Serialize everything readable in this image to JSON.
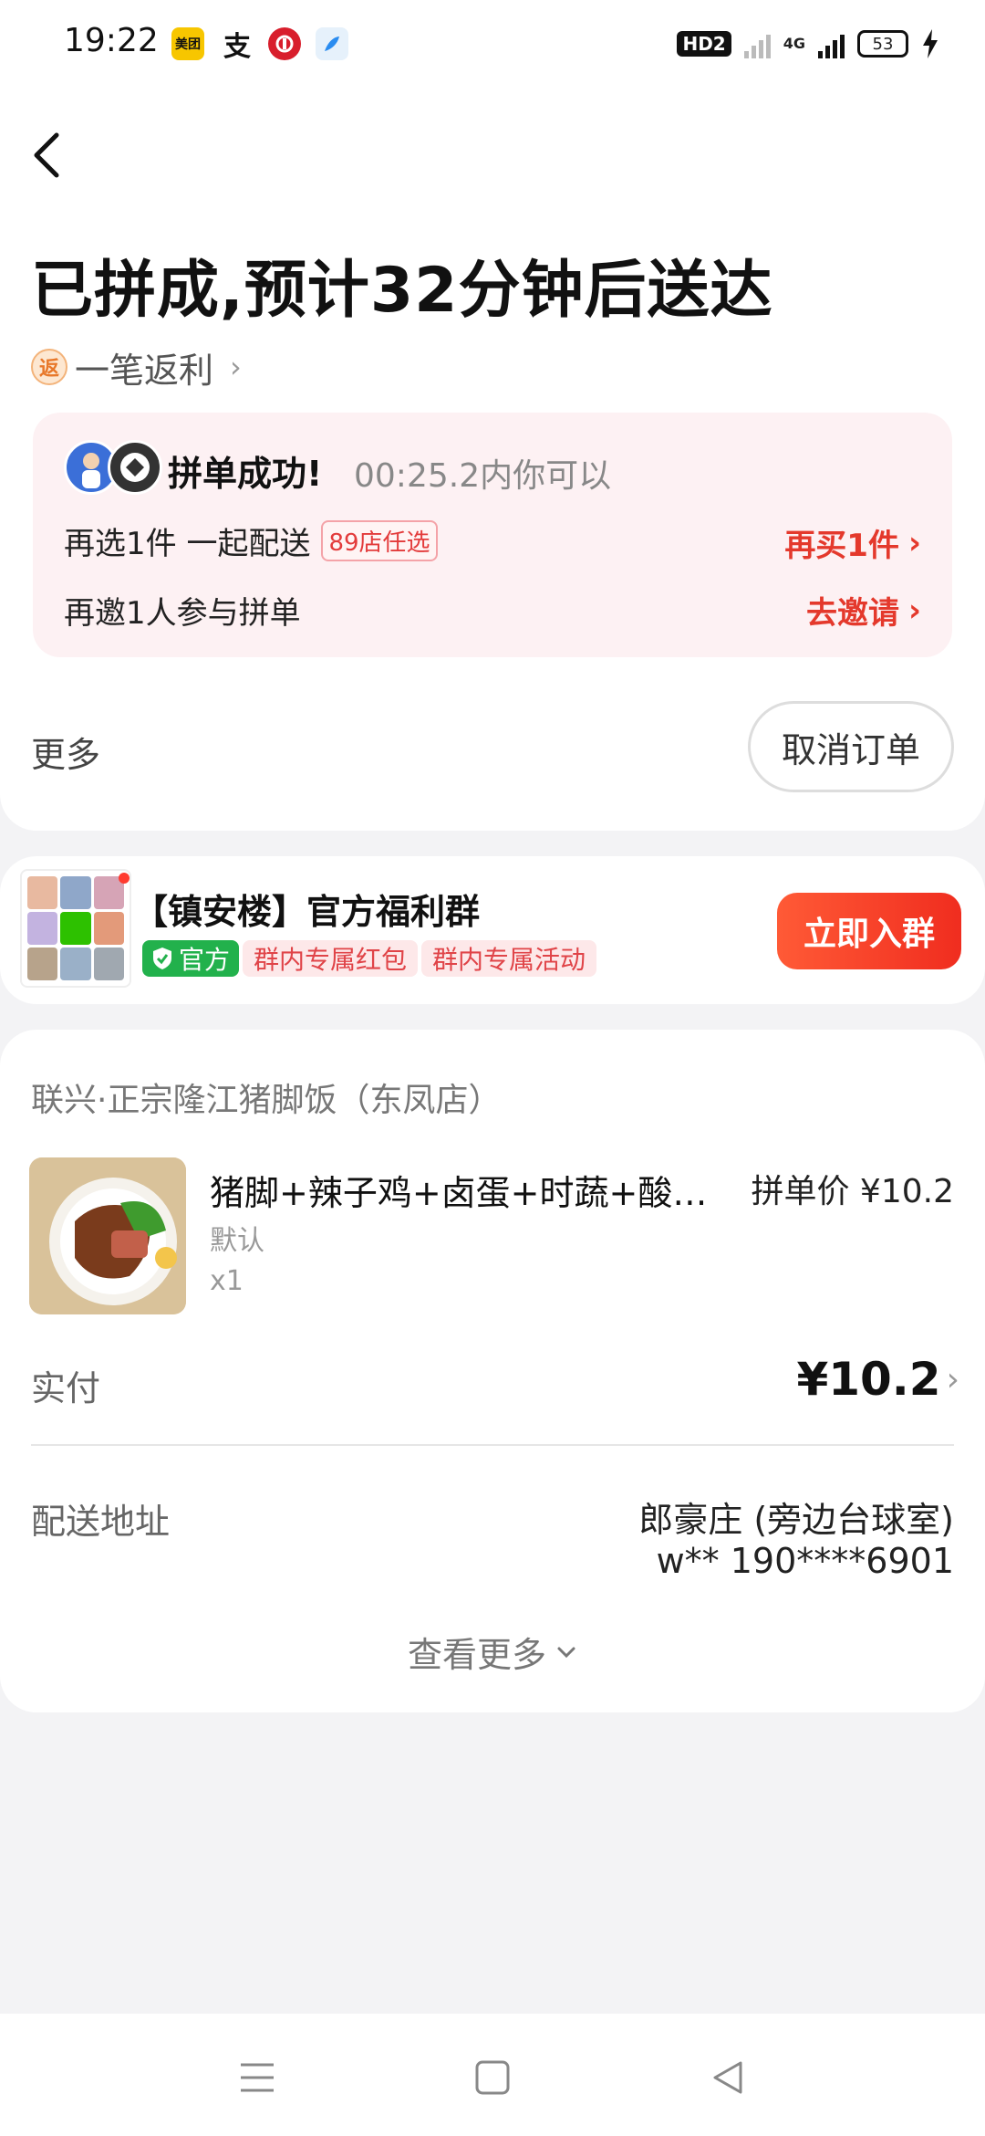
{
  "status_bar": {
    "time": "19:22",
    "app_icons": [
      "meituan-icon",
      "alipay-icon",
      "bank-icon",
      "feather-icon"
    ],
    "meituan_label": "美团",
    "alipay_label": "支",
    "hd_label": "HD2",
    "network_label": "4G",
    "battery_level": "53"
  },
  "header": {
    "title": "已拼成,预计32分钟后送达",
    "rebate_badge": "返",
    "rebate_text": "一笔返利"
  },
  "pin_card": {
    "success_text": "拼单成功!",
    "timer_text": "00:25.2内你可以",
    "row1_label": "再选1件 一起配送",
    "row1_tag": "89店任选",
    "row1_action": "再买1件",
    "row2_label": "再邀1人参与拼单",
    "row2_action": "去邀请"
  },
  "more_row": {
    "label": "更多",
    "cancel_button": "取消订单"
  },
  "group": {
    "title": "【镇安楼】官方福利群",
    "official_tag": "官方",
    "tag1": "群内专属红包",
    "tag2": "群内专属活动",
    "join_button": "立即入群"
  },
  "order": {
    "shop_name": "联兴·正宗隆江猪脚饭（东凤店）",
    "item": {
      "name": "猪脚+辣子鸡+卤蛋+时蔬+酸菜...",
      "price": "拼单价 ¥10.2",
      "spec": "默认",
      "quantity": "x1"
    },
    "paid_label": "实付",
    "paid_value": "¥10.2",
    "address_label": "配送地址",
    "address_main": "郎豪庄 (旁边台球室)",
    "address_contact": "w** 190****6901",
    "see_more": "查看更多"
  },
  "colors": {
    "accent_red": "#e4392c",
    "pin_bg": "#fdf1f3",
    "official_green": "#22b14c"
  }
}
